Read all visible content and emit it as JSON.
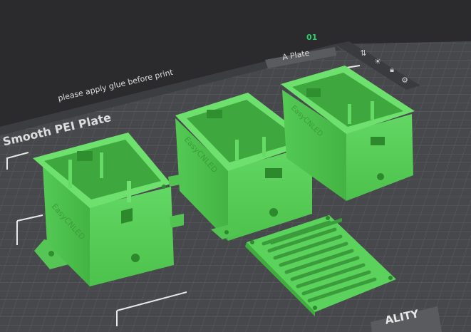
{
  "viewport": {
    "plate_number": "01",
    "plate_name": "A Plate",
    "plate_type": "Smooth PEI Plate",
    "plate_note": "please apply glue before print",
    "corner_text": "ALITY",
    "model_text": "EasyCNLED"
  },
  "toolbar": {
    "icons": [
      "arrange-icon",
      "lock-icon",
      "settings-icon"
    ]
  },
  "colors": {
    "background": "#2b2b2d",
    "plate": "#4a4b4e",
    "grid": "#5e6063",
    "model": "#5fd35f",
    "model_dark": "#3fae3f",
    "accent": "#2fd06b"
  }
}
